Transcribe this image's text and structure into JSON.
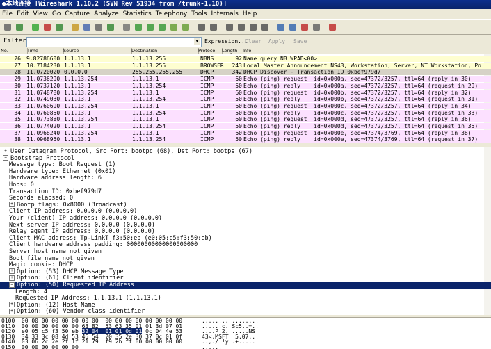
{
  "window": {
    "title": "●本地连接  [Wireshark 1.10.2  (SVN Rev 51934 from /trunk-1.10)]"
  },
  "menu": [
    "File",
    "Edit",
    "View",
    "Go",
    "Capture",
    "Analyze",
    "Statistics",
    "Telephony",
    "Tools",
    "Internals",
    "Help"
  ],
  "toolbar": {
    "icons": [
      "interface-list-icon",
      "capture-options-icon",
      "start-capture-icon",
      "stop-capture-icon",
      "restart-capture-icon",
      "open-file-icon",
      "save-file-icon",
      "close-file-icon",
      "reload-icon",
      "find-icon",
      "back-icon",
      "forward-icon",
      "go-to-icon",
      "first-packet-icon",
      "last-packet-icon",
      "colorize-icon",
      "auto-scroll-icon",
      "zoom-in-icon",
      "zoom-out-icon",
      "zoom-normal-icon",
      "resize-columns-icon",
      "capture-filters-icon",
      "display-filters-icon",
      "coloring-rules-icon",
      "preferences-icon",
      "help-icon"
    ]
  },
  "filter": {
    "label": "Filter:",
    "value": "",
    "expression": "Expression...",
    "clear": "Clear",
    "apply": "Apply",
    "save": "Save"
  },
  "columns": [
    "No.",
    "Time",
    "Source",
    "Destination",
    "Protocol",
    "Length",
    "Info"
  ],
  "packets": [
    {
      "no": "26",
      "time": "9.82786600",
      "src": "1.1.13.1",
      "dst": "1.1.13.255",
      "proto": "NBNS",
      "len": "92",
      "info": "Name query NB WPAD<00>",
      "color": "#fefed0"
    },
    {
      "no": "27",
      "time": "10.7184230",
      "src": "1.1.13.1",
      "dst": "1.1.13.255",
      "proto": "BROWSER",
      "len": "243",
      "info": "Local Master Announcement NS43, Workstation, Server, NT Workstation, Po",
      "color": "#fefed0"
    },
    {
      "no": "28",
      "time": "11.0720020",
      "src": "0.0.0.0",
      "dst": "255.255.255.255",
      "proto": "DHCP",
      "len": "342",
      "info": "DHCP Discover - Transaction ID 0xbef979d7",
      "color": "#d6d2c6"
    },
    {
      "no": "29",
      "time": "11.0736290",
      "src": "1.1.13.254",
      "dst": "1.1.13.1",
      "proto": "ICMP",
      "len": "60",
      "info": "Echo (ping) request  id=0x000a, seq=47372/3257, ttl=64 (reply in 30)",
      "color": "#fce0ff"
    },
    {
      "no": "30",
      "time": "11.0737120",
      "src": "1.1.13.1",
      "dst": "1.1.13.254",
      "proto": "ICMP",
      "len": "50",
      "info": "Echo (ping) reply    id=0x000a, seq=47372/3257, ttl=64 (request in 29)",
      "color": "#fce0ff"
    },
    {
      "no": "31",
      "time": "11.0748780",
      "src": "1.1.13.254",
      "dst": "1.1.13.1",
      "proto": "ICMP",
      "len": "60",
      "info": "Echo (ping) request  id=0x000b, seq=47372/3257, ttl=64 (reply in 32)",
      "color": "#fce0ff"
    },
    {
      "no": "32",
      "time": "11.0749030",
      "src": "1.1.13.1",
      "dst": "1.1.13.254",
      "proto": "ICMP",
      "len": "50",
      "info": "Echo (ping) reply    id=0x000b, seq=47372/3257, ttl=64 (request in 31)",
      "color": "#fce0ff"
    },
    {
      "no": "33",
      "time": "11.0760690",
      "src": "1.1.13.254",
      "dst": "1.1.13.1",
      "proto": "ICMP",
      "len": "60",
      "info": "Echo (ping) request  id=0x000c, seq=47372/3257, ttl=64 (reply in 34)",
      "color": "#fce0ff"
    },
    {
      "no": "34",
      "time": "11.0760850",
      "src": "1.1.13.1",
      "dst": "1.1.13.254",
      "proto": "ICMP",
      "len": "50",
      "info": "Echo (ping) reply    id=0x000c, seq=47372/3257, ttl=64 (request in 33)",
      "color": "#fce0ff"
    },
    {
      "no": "35",
      "time": "11.0773880",
      "src": "1.1.13.254",
      "dst": "1.1.13.1",
      "proto": "ICMP",
      "len": "60",
      "info": "Echo (ping) request  id=0x000d, seq=47372/3257, ttl=64 (reply in 36)",
      "color": "#fce0ff"
    },
    {
      "no": "36",
      "time": "11.0774020",
      "src": "1.1.13.1",
      "dst": "1.1.13.254",
      "proto": "ICMP",
      "len": "50",
      "info": "Echo (ping) reply    id=0x000d, seq=47372/3257, ttl=64 (request in 35)",
      "color": "#fce0ff"
    },
    {
      "no": "37",
      "time": "11.0968240",
      "src": "1.1.13.254",
      "dst": "1.1.13.1",
      "proto": "ICMP",
      "len": "60",
      "info": "Echo (ping) request  id=0x000e, seq=47374/3769, ttl=64 (reply in 38)",
      "color": "#fce0ff"
    },
    {
      "no": "38",
      "time": "11.0968950",
      "src": "1.1.13.1",
      "dst": "1.1.13.254",
      "proto": "ICMP",
      "len": "50",
      "info": "Echo (ping) reply    id=0x000e, seq=47374/3769, ttl=64 (request in 37)",
      "color": "#fce0ff"
    }
  ],
  "details": [
    {
      "text": "User Datagram Protocol, Src Port: bootpc (68), Dst Port: bootps (67)",
      "indent": 0,
      "exp": "+"
    },
    {
      "text": "Bootstrap Protocol",
      "indent": 0,
      "exp": "-"
    },
    {
      "text": "Message type: Boot Request (1)",
      "indent": 1,
      "exp": ""
    },
    {
      "text": "Hardware type: Ethernet (0x01)",
      "indent": 1,
      "exp": ""
    },
    {
      "text": "Hardware address length: 6",
      "indent": 1,
      "exp": ""
    },
    {
      "text": "Hops: 0",
      "indent": 1,
      "exp": ""
    },
    {
      "text": "Transaction ID: 0xbef979d7",
      "indent": 1,
      "exp": ""
    },
    {
      "text": "Seconds elapsed: 0",
      "indent": 1,
      "exp": ""
    },
    {
      "text": "Bootp flags: 0x8000 (Broadcast)",
      "indent": 1,
      "exp": "+"
    },
    {
      "text": "Client IP address: 0.0.0.0 (0.0.0.0)",
      "indent": 1,
      "exp": ""
    },
    {
      "text": "Your (client) IP address: 0.0.0.0 (0.0.0.0)",
      "indent": 1,
      "exp": ""
    },
    {
      "text": "Next server IP address: 0.0.0.0 (0.0.0.0)",
      "indent": 1,
      "exp": ""
    },
    {
      "text": "Relay agent IP address: 0.0.0.0 (0.0.0.0)",
      "indent": 1,
      "exp": ""
    },
    {
      "text": "Client MAC address: Tp-LinkT_f3:50:eb (e0:05:c5:f3:50:eb)",
      "indent": 1,
      "exp": ""
    },
    {
      "text": "Client hardware address padding: 00000000000000000000",
      "indent": 1,
      "exp": ""
    },
    {
      "text": "Server host name not given",
      "indent": 1,
      "exp": ""
    },
    {
      "text": "Boot file name not given",
      "indent": 1,
      "exp": ""
    },
    {
      "text": "Magic cookie: DHCP",
      "indent": 1,
      "exp": ""
    },
    {
      "text": "Option: (53) DHCP Message Type",
      "indent": 1,
      "exp": "+"
    },
    {
      "text": "Option: (61) Client identifier",
      "indent": 1,
      "exp": "+"
    },
    {
      "text": "Option: (50) Requested IP Address",
      "indent": 1,
      "exp": "-",
      "selected": true
    },
    {
      "text": "Length: 4",
      "indent": 2,
      "exp": ""
    },
    {
      "text": "Requested IP Address: 1.1.13.1 (1.1.13.1)",
      "indent": 2,
      "exp": ""
    },
    {
      "text": "Option: (12) Host Name",
      "indent": 1,
      "exp": "+"
    },
    {
      "text": "Option: (60) Vendor class identifier",
      "indent": 1,
      "exp": "+"
    }
  ],
  "hex": [
    {
      "off": "0100",
      "pre": "00 00 00 00 00 00 00 00  00 00 00 00 00 00 00 00",
      "hl": "",
      "post": "",
      "ascii": "........ ........"
    },
    {
      "off": "0110",
      "pre": "00 00 00 00 00 00 63 82  53 63 35 01 01 3d 07 01",
      "hl": "",
      "post": "",
      "ascii": "......c. Sc5..=.."
    },
    {
      "off": "0120",
      "pre": "e0 05 c5 f3 50 eb ",
      "hl": "32 04  01 01 0d 01",
      "post": " 0c 04 4e 53",
      "ascii": "....P.2. .....NS"
    },
    {
      "off": "0130",
      "pre": "34 33 3c 08 4d 53 46 54  20 35 2e 30 37 0c 01 0f",
      "hl": "",
      "post": "",
      "ascii": "43<.MSFT  5.07..."
    },
    {
      "off": "0140",
      "pre": "03 06 2c 2e 2f 1f 21 79  f9 2b ff 00 00 00 00 00",
      "hl": "",
      "post": "",
      "ascii": "..,./.!y .+......"
    },
    {
      "off": "0150",
      "pre": "00 00 00 00 00 00",
      "hl": "",
      "post": "",
      "ascii": "......"
    }
  ]
}
